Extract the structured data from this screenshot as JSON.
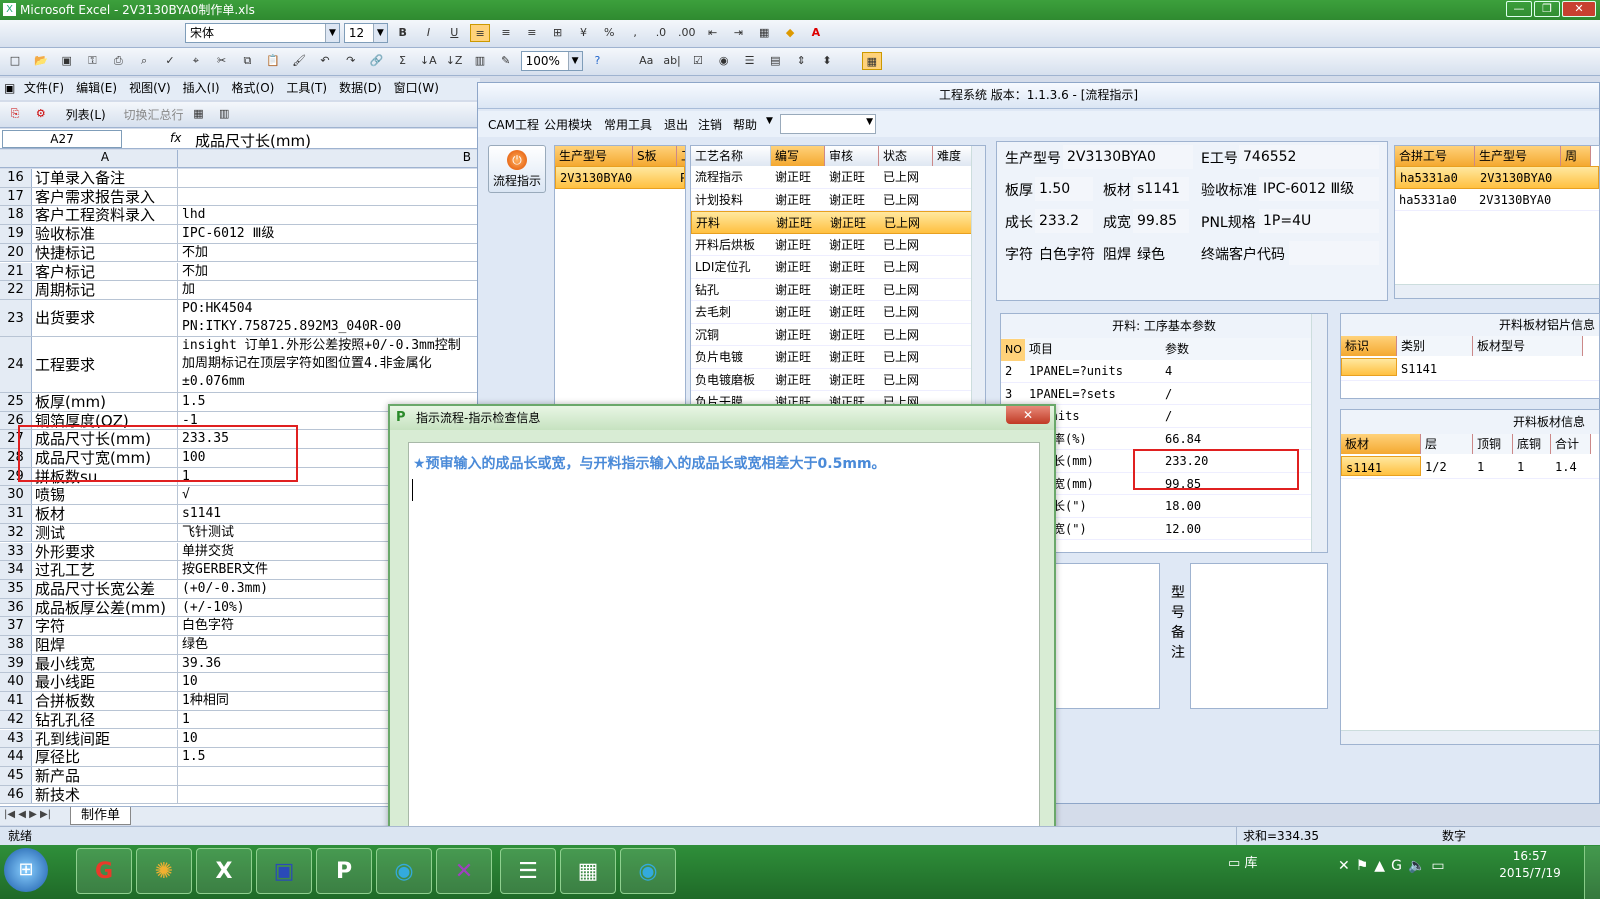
{
  "excel": {
    "title": "Microsoft Excel - 2V3130BYA0制作单.xls",
    "font_name": "宋体",
    "font_size": "12",
    "zoom": "100%",
    "menus": [
      "文件(F)",
      "编辑(E)",
      "视图(V)",
      "插入(I)",
      "格式(O)",
      "工具(T)",
      "数据(D)",
      "窗口(W)"
    ],
    "toolbar3": {
      "list": "列表(L)",
      "toggle_total": "切换汇总行"
    },
    "name_box": "A27",
    "fx": "fx",
    "formula": "成品尺寸长(mm)",
    "col_a": "A",
    "col_b": "B",
    "rows": [
      {
        "n": "16",
        "a": "订单录入备注",
        "b": ""
      },
      {
        "n": "17",
        "a": "客户需求报告录入",
        "b": ""
      },
      {
        "n": "18",
        "a": "客户工程资料录入",
        "b": "lhd"
      },
      {
        "n": "19",
        "a": "验收标准",
        "b": "IPC-6012 Ⅲ级"
      },
      {
        "n": "20",
        "a": "快捷标记",
        "b": "不加"
      },
      {
        "n": "21",
        "a": "客户标记",
        "b": "不加"
      },
      {
        "n": "22",
        "a": "周期标记",
        "b": "加"
      },
      {
        "n": "23",
        "a": "出货要求",
        "b": "PO:HK4504",
        "b2": "PN:ITKY.758725.892M3_040R-00"
      },
      {
        "n": "24",
        "a": "工程要求",
        "b": "insight 订单1.外形公差按照+0/-0.3mm控制",
        "b2": "加周期标记在顶层字符如图位置4.非金属化",
        "b3": "±0.076mm"
      },
      {
        "n": "25",
        "a": "板厚(mm)",
        "b": "1.5"
      },
      {
        "n": "26",
        "a": "铜箔厚度(OZ)",
        "b": "-1"
      },
      {
        "n": "27",
        "a": "成品尺寸长(mm)",
        "b": "233.35"
      },
      {
        "n": "28",
        "a": "成品尺寸宽(mm)",
        "b": "100"
      },
      {
        "n": "29",
        "a": "拼板数su",
        "b": "1"
      },
      {
        "n": "30",
        "a": "喷锡",
        "b": "√"
      },
      {
        "n": "31",
        "a": "板材",
        "b": "s1141"
      },
      {
        "n": "32",
        "a": "测试",
        "b": "飞针测试"
      },
      {
        "n": "33",
        "a": "外形要求",
        "b": "单拼交货"
      },
      {
        "n": "34",
        "a": "过孔工艺",
        "b": "按GERBER文件"
      },
      {
        "n": "35",
        "a": "成品尺寸长宽公差",
        "b": "(+0/-0.3mm)"
      },
      {
        "n": "36",
        "a": "成品板厚公差(mm)",
        "b": "(+/-10%)"
      },
      {
        "n": "37",
        "a": "字符",
        "b": "白色字符"
      },
      {
        "n": "38",
        "a": "阻焊",
        "b": "绿色"
      },
      {
        "n": "39",
        "a": "最小线宽",
        "b": "39.36"
      },
      {
        "n": "40",
        "a": "最小线距",
        "b": "10"
      },
      {
        "n": "41",
        "a": "合拼板数",
        "b": "1种相同"
      },
      {
        "n": "42",
        "a": "钻孔孔径",
        "b": "1"
      },
      {
        "n": "43",
        "a": "孔到线间距",
        "b": "10"
      },
      {
        "n": "44",
        "a": "厚径比",
        "b": "1.5"
      },
      {
        "n": "45",
        "a": "新产品",
        "b": ""
      },
      {
        "n": "46",
        "a": "新技术",
        "b": ""
      }
    ],
    "sheet_tab": "制作单",
    "status_ready": "就绪",
    "status_sum": "求和=334.35",
    "status_num": "数字"
  },
  "cam": {
    "title": "工程系统   版本：1.1.3.6 - [流程指示]",
    "menus": [
      "CAM工程",
      "公用模块",
      "常用工具",
      "退出",
      "注销",
      "帮助"
    ],
    "side_button": "流程指示",
    "left_grid": {
      "headers": [
        "生产型号",
        "S板",
        "工"
      ],
      "rows": [
        [
          "2V3130BYA0",
          "",
          "P"
        ]
      ]
    },
    "process_grid": {
      "headers": [
        "工艺名称",
        "编写",
        "审核",
        "状态",
        "难度"
      ],
      "rows": [
        [
          "流程指示",
          "谢正旺",
          "谢正旺",
          "已上网"
        ],
        [
          "计划投料",
          "谢正旺",
          "谢正旺",
          "已上网"
        ],
        [
          "开料",
          "谢正旺",
          "谢正旺",
          "已上网"
        ],
        [
          "开料后烘板",
          "谢正旺",
          "谢正旺",
          "已上网"
        ],
        [
          "LDI定位孔",
          "谢正旺",
          "谢正旺",
          "已上网"
        ],
        [
          "钻孔",
          "谢正旺",
          "谢正旺",
          "已上网"
        ],
        [
          "去毛刺",
          "谢正旺",
          "谢正旺",
          "已上网"
        ],
        [
          "沉铜",
          "谢正旺",
          "谢正旺",
          "已上网"
        ],
        [
          "负片电镀",
          "谢正旺",
          "谢正旺",
          "已上网"
        ],
        [
          "负电镀磨板",
          "谢正旺",
          "谢正旺",
          "已上网"
        ],
        [
          "负片干膜",
          "谢正旺",
          "谢正旺",
          "已上网"
        ]
      ]
    },
    "info": {
      "model_label": "生产型号",
      "model": "2V3130BYA0",
      "e_label": "E工号",
      "e": "746552",
      "thick_label": "板厚",
      "thick": "1.50",
      "mat_label": "板材",
      "mat": "s1141",
      "std_label": "验收标准",
      "std": "IPC-6012 Ⅲ级",
      "len_label": "成长",
      "len": "233.2",
      "wid_label": "成宽",
      "wid": "99.85",
      "pnl_label": "PNL规格",
      "pnl": "1P=4U",
      "char_label": "字符",
      "char": "白色字符",
      "mask_label": "阻焊",
      "mask": "绿色",
      "cust_label": "终端客户代码",
      "cust": ""
    },
    "combine_grid": {
      "headers": [
        "合拼工号",
        "生产型号",
        "周"
      ],
      "rows": [
        [
          "ha5331a0",
          "2V3130BYA0"
        ],
        [
          "ha5331a0",
          "2V3130BYA0"
        ]
      ]
    },
    "params": {
      "title": "开料: 工序基本参数",
      "headers": [
        "NO",
        "项目",
        "参数"
      ],
      "rows": [
        [
          "2",
          "1PANEL=?units",
          "4"
        ],
        [
          "3",
          "1PANEL=?sets",
          "/"
        ],
        [
          "",
          "=?units",
          "/"
        ],
        [
          "",
          "利用率(%)",
          "66.84"
        ],
        [
          "",
          "尺寸长(mm)",
          "233.20"
        ],
        [
          "",
          "尺寸宽(mm)",
          "99.85"
        ],
        [
          "",
          "尺寸长(\")",
          "18.00"
        ],
        [
          "",
          "尺寸宽(\")",
          "12.00"
        ]
      ]
    },
    "model_note": [
      "型",
      "号",
      "备",
      "注"
    ],
    "sheet_info": {
      "title": "开料板材铝片信息",
      "headers": [
        "标识",
        "类别",
        "板材型号"
      ],
      "row": [
        "",
        "S1141",
        ""
      ]
    },
    "board_info": {
      "title": "开料板材信息",
      "headers": [
        "板材",
        "层",
        "顶铜",
        "底铜",
        "合计"
      ],
      "row": [
        "s1141",
        "1/2",
        "1",
        "1",
        "1.4"
      ]
    }
  },
  "dialog": {
    "title": "指示流程-指示检查信息",
    "message": "★预审输入的成品长或宽，与开料指示输入的成品长或宽相差大于0.5mm。"
  },
  "taskbar": {
    "lib": "库",
    "time": "16:57",
    "date": "2015/7/19"
  }
}
